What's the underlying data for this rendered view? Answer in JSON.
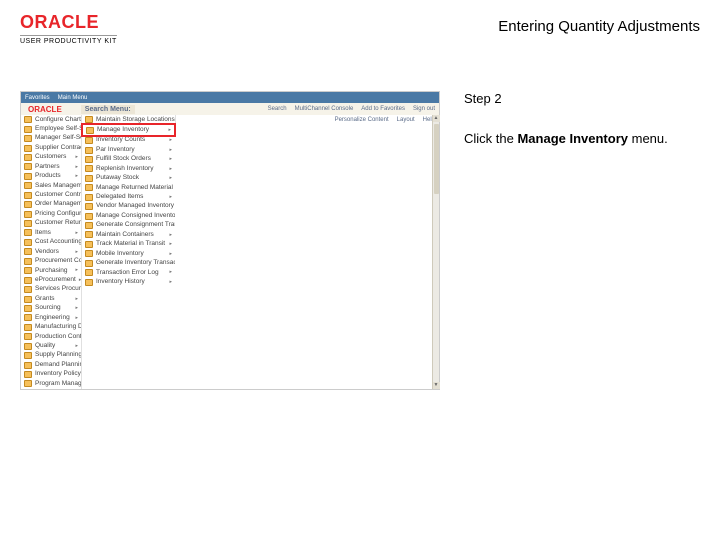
{
  "header": {
    "logo_text": "ORACLE",
    "upk_text": "USER PRODUCTIVITY KIT",
    "title": "Entering Quantity Adjustments"
  },
  "instructions": {
    "step_label": "Step 2",
    "text_prefix": "Click the ",
    "target": "Manage Inventory",
    "text_suffix": " menu."
  },
  "ps": {
    "topbar": {
      "fav": "Favorites",
      "main": "Main Menu"
    },
    "secbar": {
      "search_label": "Search Menu:",
      "links": [
        "Search",
        "MultiChannel Console",
        "Add to Favorites",
        "Sign out"
      ]
    },
    "rest": {
      "personalize": "Personalize Content",
      "layout": "Layout",
      "help": "Help"
    },
    "col1": [
      "Configure Chart",
      "Employee Self-Service",
      "Manager Self-Service",
      "Supplier Contracts",
      "Customers",
      "Partners",
      "Products",
      "Sales Management",
      "Customer Contracts",
      "Order Management",
      "Pricing Configuration",
      "Customer Returns",
      "Items",
      "Cost Accounting",
      "Vendors",
      "Procurement Contracts",
      "Purchasing",
      "eProcurement",
      "Services Procurement",
      "Grants",
      "Sourcing",
      "Engineering",
      "Manufacturing Definitions",
      "Production Control",
      "Quality",
      "Supply Planning",
      "Demand Planning",
      "Inventory Policy Planning",
      "Program Management"
    ],
    "col2": [
      "Maintain Storage Locations",
      "Manage Inventory",
      "Inventory Counts",
      "Par Inventory",
      "Fulfill Stock Orders",
      "Replenish Inventory",
      "Putaway Stock",
      "Manage Returned Material",
      "Delegated Items",
      "Vendor Managed Inventory",
      "Manage Consigned Inventory",
      "Generate Consignment Transactions",
      "Maintain Containers",
      "Track Material in Transit",
      "Mobile Inventory",
      "Generate Inventory Transactions",
      "Transaction Error Log",
      "Inventory History"
    ]
  }
}
